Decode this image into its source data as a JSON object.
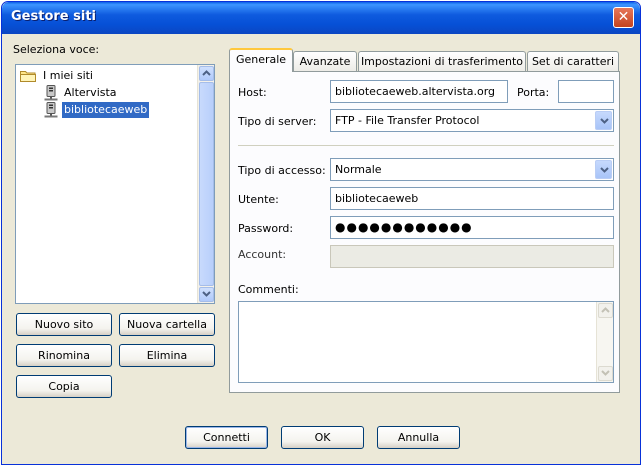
{
  "window": {
    "title": "Gestore siti",
    "close_glyph": "✕"
  },
  "tree": {
    "label": "Seleziona voce:",
    "root": "I miei siti",
    "sites": [
      "Altervista",
      "bibliotecaeweb"
    ],
    "selected": "bibliotecaeweb"
  },
  "left_buttons": {
    "new_site": "Nuovo sito",
    "new_folder": "Nuova cartella",
    "rename": "Rinomina",
    "delete": "Elimina",
    "copy": "Copia"
  },
  "tabs": [
    {
      "label": "Generale",
      "active": true
    },
    {
      "label": "Avanzate",
      "active": false
    },
    {
      "label": "Impostazioni di trasferimento",
      "active": false
    },
    {
      "label": "Set di caratteri",
      "active": false
    }
  ],
  "form": {
    "host_label": "Host:",
    "host_value": "bibliotecaeweb.altervista.org",
    "port_label": "Porta:",
    "port_value": "",
    "server_type_label": "Tipo di server:",
    "server_type_value": "FTP - File Transfer Protocol",
    "access_type_label": "Tipo di accesso:",
    "access_type_value": "Normale",
    "user_label": "Utente:",
    "user_value": "bibliotecaeweb",
    "password_label": "Password:",
    "password_value": "●●●●●●●●●●●●",
    "account_label": "Account:",
    "account_value": "",
    "comments_label": "Commenti:",
    "comments_value": ""
  },
  "bottom_buttons": {
    "connect": "Connetti",
    "ok": "OK",
    "cancel": "Annulla"
  },
  "icons": {
    "close": "close-icon",
    "folder": "folder-icon",
    "server": "server-icon",
    "scroll_up": "chevron-up-icon",
    "scroll_down": "chevron-down-icon",
    "combo": "chevron-down-icon"
  },
  "colors": {
    "titlebar": "#0a5fe8",
    "window_bg": "#ece9d8",
    "selection": "#316ac5",
    "active_tab_accent": "#ffc83c"
  }
}
